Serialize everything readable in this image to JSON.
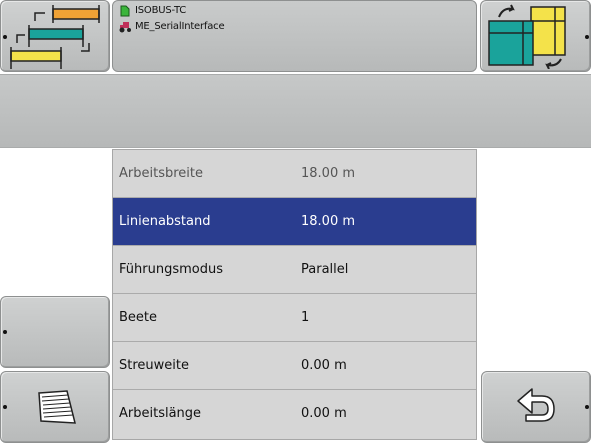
{
  "header": {
    "info_lines": [
      {
        "icon": "document-icon",
        "text": "ISOBUS-TC"
      },
      {
        "icon": "tractor-icon",
        "text": "ME_SerialInterface"
      }
    ]
  },
  "parameters": [
    {
      "label": "Arbeitsbreite",
      "value": "18.00 m",
      "state": "dim"
    },
    {
      "label": "Linienabstand",
      "value": "18.00 m",
      "state": "selected"
    },
    {
      "label": "Führungsmodus",
      "value": "Parallel",
      "state": "normal"
    },
    {
      "label": "Beete",
      "value": "1",
      "state": "normal"
    },
    {
      "label": "Streuweite",
      "value": "0.00 m",
      "state": "normal"
    },
    {
      "label": "Arbeitslänge",
      "value": "0.00 m",
      "state": "normal"
    }
  ],
  "colors": {
    "selected_row": "#2a3d8f",
    "panel_gray": "#c0c2c2"
  },
  "icons": {
    "top_left_button": "field-layout-switch-icon",
    "top_right_button": "window-swap-icon",
    "bottom_left_button": "field-pattern-icon",
    "bottom_right_button": "back-arrow-icon"
  }
}
